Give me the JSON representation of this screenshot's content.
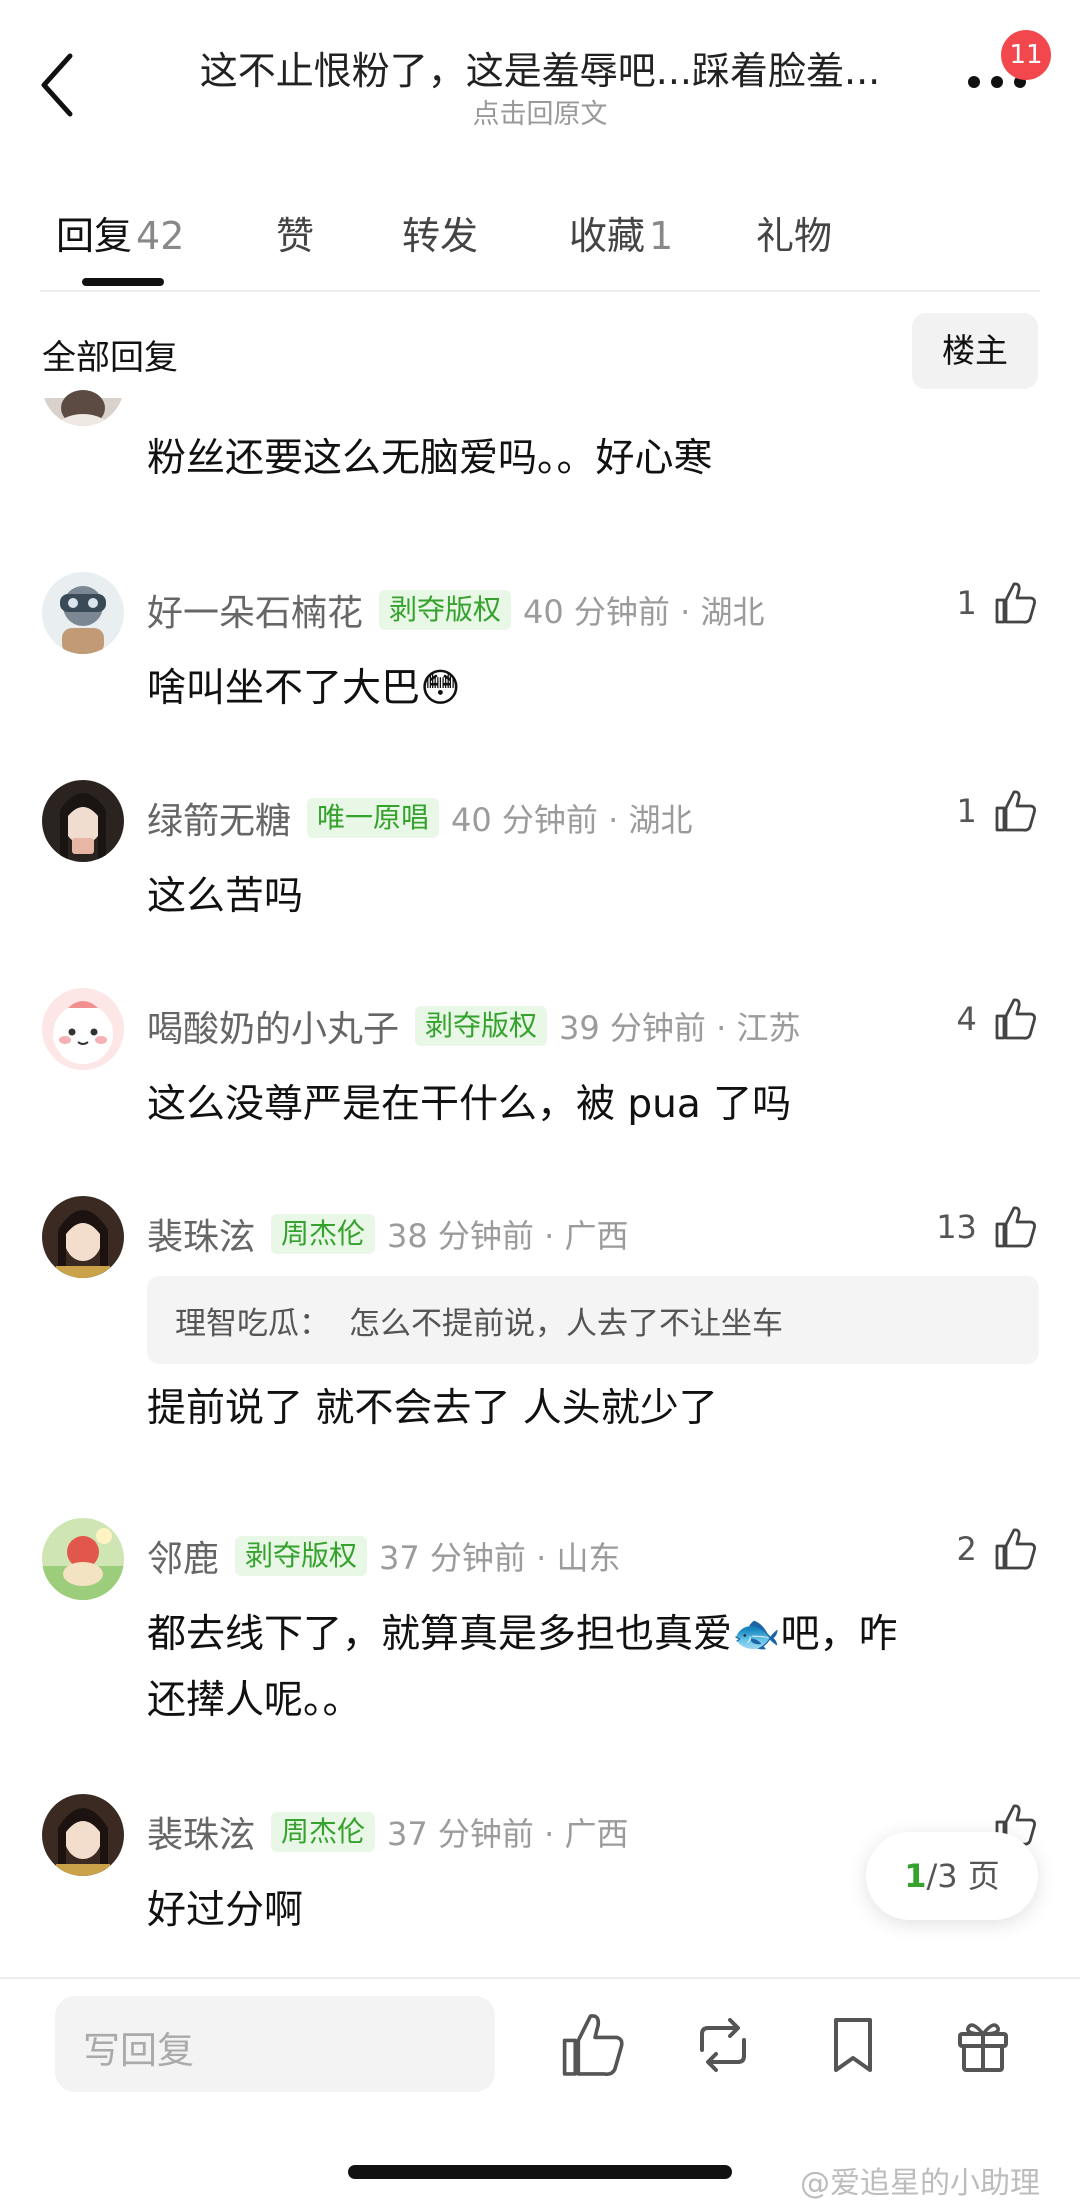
{
  "header": {
    "title": "这不止恨粉了，这是羞辱吧...踩着脸羞...",
    "subtitle": "点击回原文",
    "notification_count": "11"
  },
  "tabs": [
    {
      "label": "回复",
      "count": "42"
    },
    {
      "label": "赞",
      "count": ""
    },
    {
      "label": "转发",
      "count": ""
    },
    {
      "label": "收藏",
      "count": "1"
    },
    {
      "label": "礼物",
      "count": ""
    }
  ],
  "filter": {
    "label": "全部回复",
    "op_button": "楼主"
  },
  "partial_comment": {
    "text": "粉丝还要这么无脑爱吗。。好心寒"
  },
  "comments": [
    {
      "name": "好一朵石楠花",
      "badge": "剥夺版权",
      "time": "40 分钟前 · 湖北",
      "likes": "1",
      "text": "啥叫坐不了大巴😳"
    },
    {
      "name": "绿箭无糖",
      "badge": "唯一原唱",
      "time": "40 分钟前 · 湖北",
      "likes": "1",
      "text": "这么苦吗"
    },
    {
      "name": "喝酸奶的小丸子",
      "badge": "剥夺版权",
      "time": "39 分钟前 · 江苏",
      "likes": "4",
      "text": "这么没尊严是在干什么，被 pua 了吗"
    },
    {
      "name": "裴珠泫",
      "badge": "周杰伦",
      "time": "38 分钟前 · 广西",
      "likes": "13",
      "quote_name": "理智吃瓜：",
      "quote_text": "怎么不提前说，人去了不让坐车",
      "text": "提前说了 就不会去了 人头就少了"
    },
    {
      "name": "邻鹿",
      "badge": "剥夺版权",
      "time": "37 分钟前 · 山东",
      "likes": "2",
      "text_line1": "都去线下了，就算真是多担也真爱🐟吧，咋",
      "text_line2": "还撵人呢。。"
    },
    {
      "name": "裴珠泫",
      "badge": "周杰伦",
      "time": "37 分钟前 · 广西",
      "likes": "",
      "text": "好过分啊"
    }
  ],
  "page_indicator": {
    "current": "1",
    "total": "/3 页"
  },
  "bottom_bar": {
    "reply_placeholder": "写回复"
  },
  "watermark": "@爱追星的小助理",
  "colors": {
    "accent_green": "#35a22e",
    "badge_bg": "#e9f7e6",
    "notif_red": "#f2484d"
  }
}
